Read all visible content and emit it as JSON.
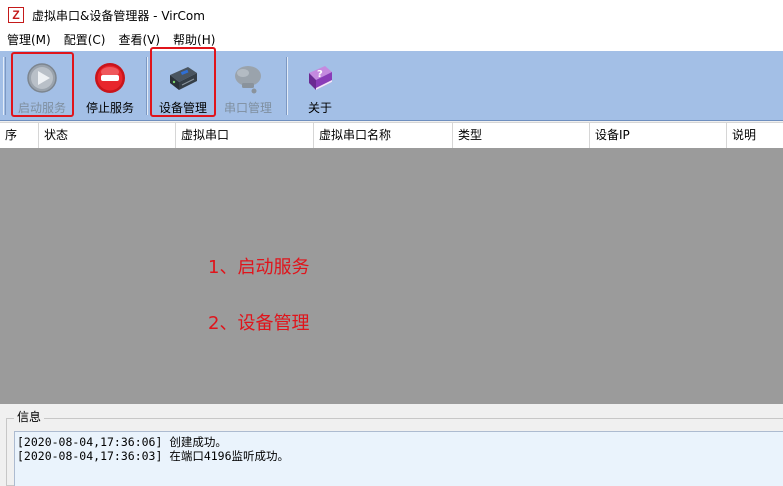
{
  "window": {
    "title": "虚拟串口&设备管理器 - VirCom",
    "icon": "z-logo-icon"
  },
  "menubar": {
    "items": [
      "管理(M)",
      "配置(C)",
      "查看(V)",
      "帮助(H)"
    ]
  },
  "toolbar": {
    "buttons": [
      {
        "label": "启动服务",
        "icon": "play-icon",
        "enabled": false,
        "highlighted": true
      },
      {
        "label": "停止服务",
        "icon": "stop-icon",
        "enabled": true,
        "highlighted": false
      },
      {
        "label": "设备管理",
        "icon": "device-icon",
        "enabled": true,
        "highlighted": true
      },
      {
        "label": "串口管理",
        "icon": "serial-port-icon",
        "enabled": false,
        "highlighted": false
      },
      {
        "label": "关于",
        "icon": "help-book-icon",
        "enabled": true,
        "highlighted": false
      }
    ]
  },
  "table": {
    "columns": [
      "序",
      "状态",
      "虚拟串口",
      "虚拟串口名称",
      "类型",
      "设备IP",
      "说明"
    ],
    "rows": []
  },
  "annotations": [
    "1、启动服务",
    "2、设备管理"
  ],
  "info": {
    "caption": "信息",
    "log": [
      "[2020-08-04,17:36:06] 创建成功。",
      "[2020-08-04,17:36:03] 在端口4196监听成功。"
    ]
  },
  "colors": {
    "toolbar_bg": "#a3bfe6",
    "grid_bg": "#9b9b9b",
    "highlight": "#e0141b",
    "log_bg": "#eaf3fc"
  }
}
